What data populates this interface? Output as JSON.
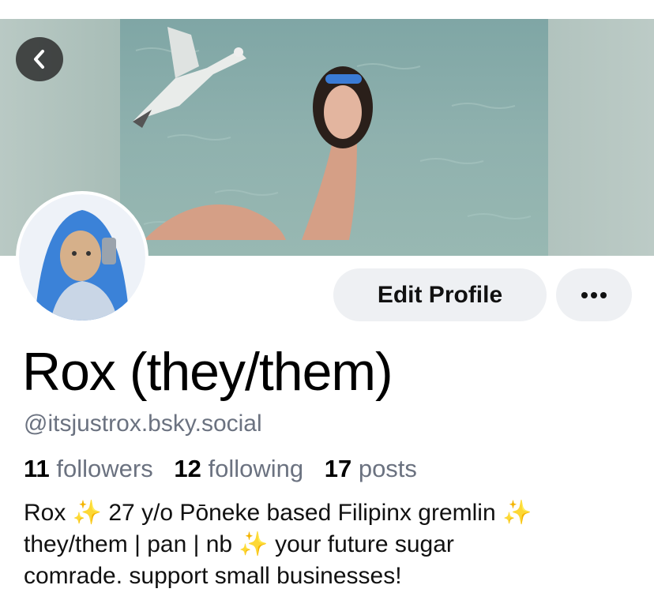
{
  "profile": {
    "display_name": "Rox (they/them)",
    "handle": "@itsjustrox.bsky.social",
    "stats": {
      "followers_count": "11",
      "followers_label": "followers",
      "following_count": "12",
      "following_label": "following",
      "posts_count": "17",
      "posts_label": "posts"
    },
    "bio": "Rox ✨ 27 y/o Pōneke based Filipinx gremlin ✨\nthey/them | pan | nb ✨ your future sugar\ncomrade. support small businesses!"
  },
  "actions": {
    "edit_profile_label": "Edit Profile",
    "more_label": "•••"
  },
  "icons": {
    "back": "chevron-left-icon",
    "more": "ellipsis-icon"
  },
  "colors": {
    "button_bg": "#eef0f3",
    "handle_text": "#6b7280",
    "back_button_bg": "#282828"
  }
}
